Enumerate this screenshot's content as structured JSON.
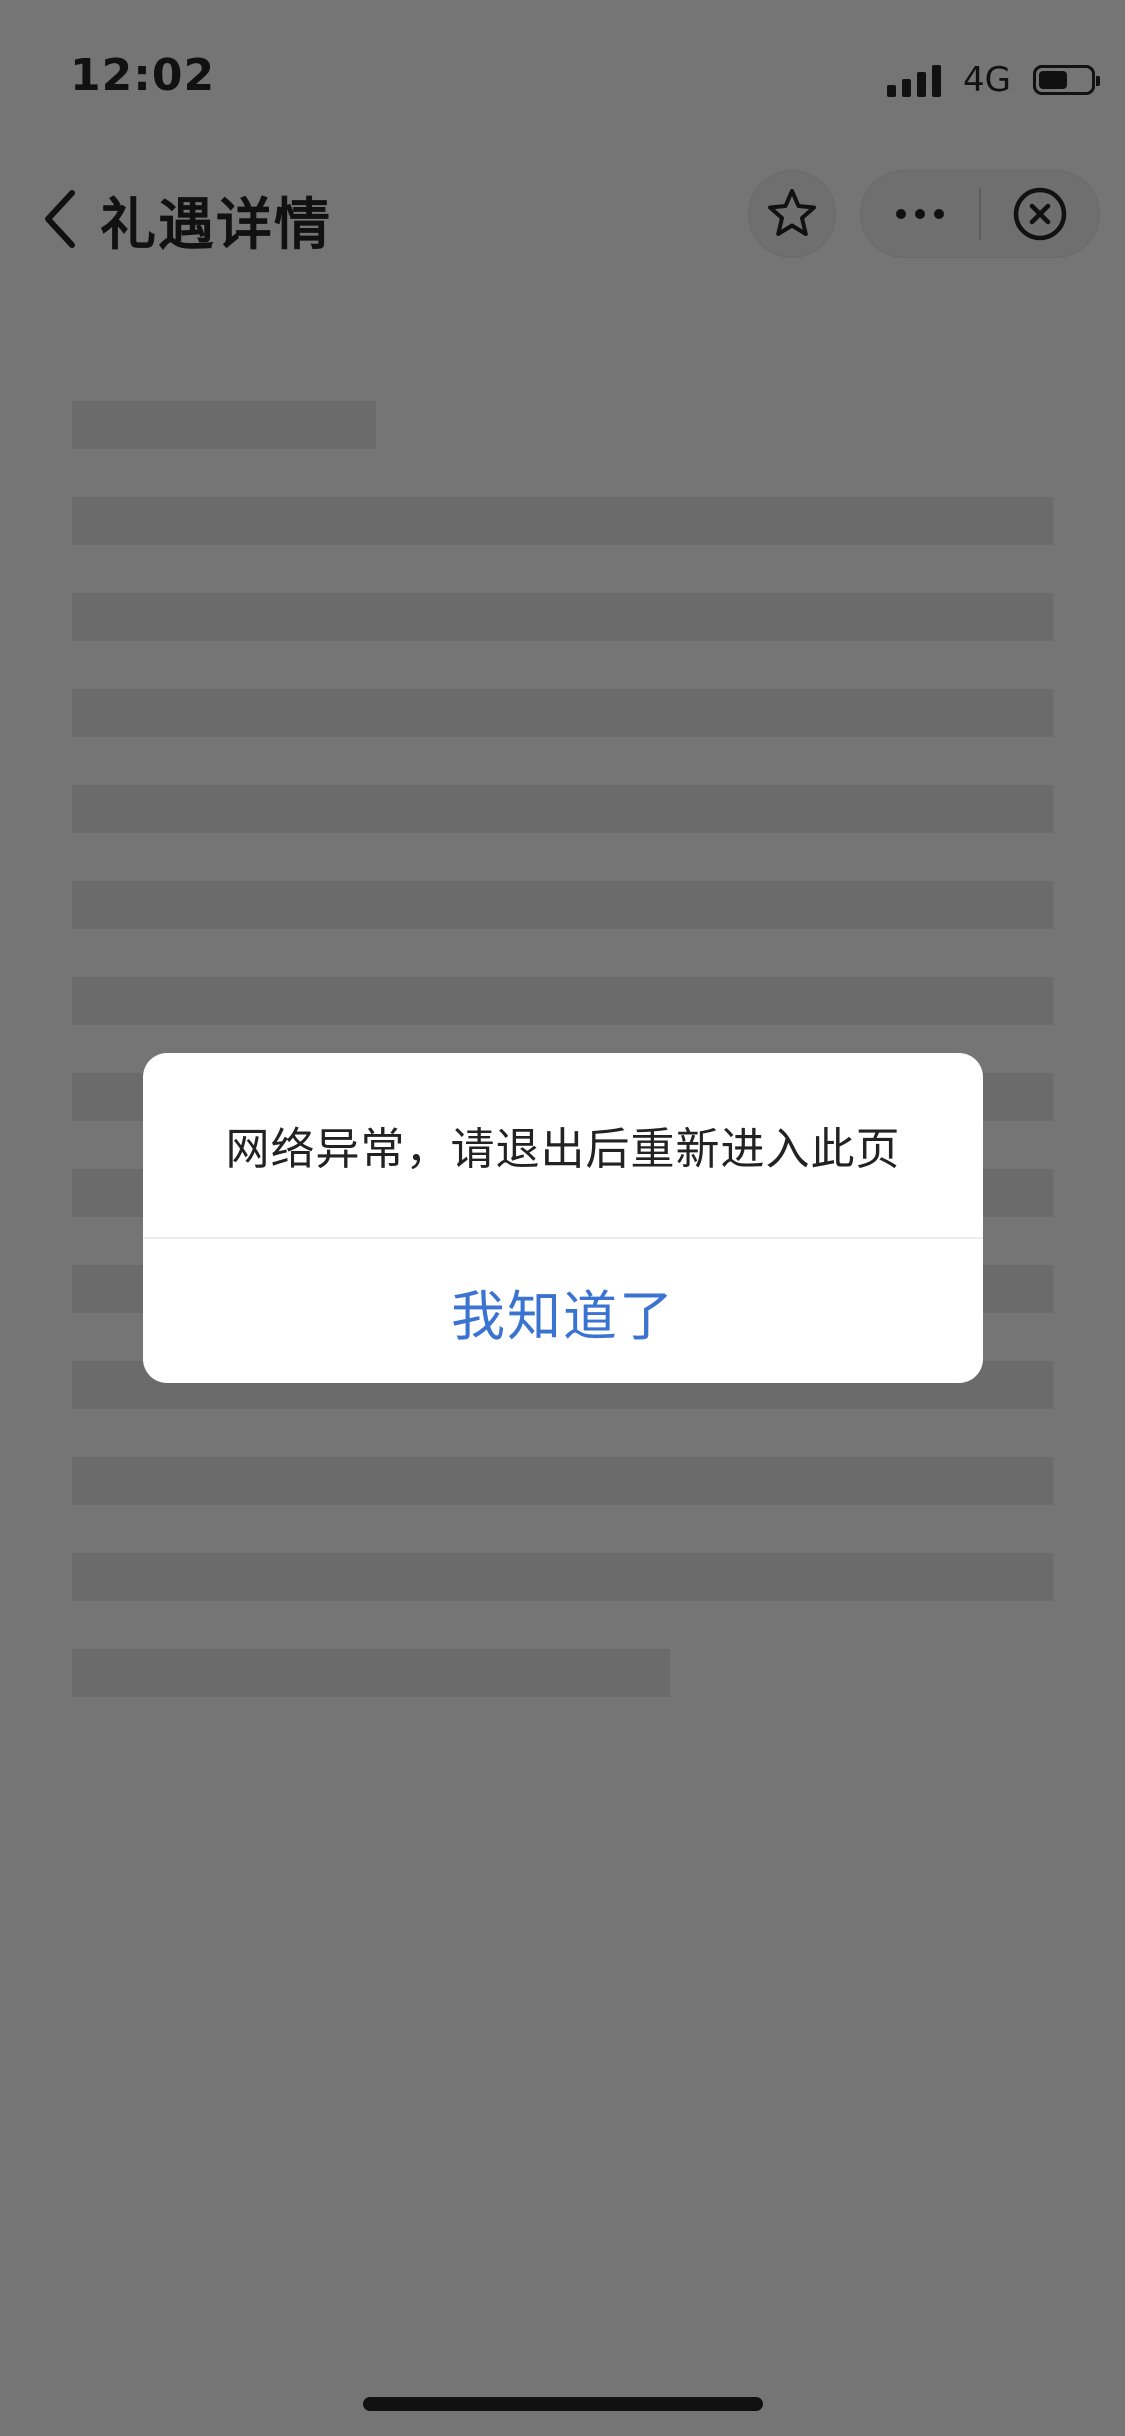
{
  "status_bar": {
    "time": "12:02",
    "network": "4G",
    "battery_level": 0.55
  },
  "nav": {
    "title": "礼遇详情",
    "icons": [
      "chevron-left-icon",
      "star-icon",
      "more-icon",
      "close-circle-icon"
    ]
  },
  "dialog": {
    "message": "网络异常，请退出后重新进入此页",
    "confirm_label": "我知道了",
    "confirm_color": "#3b73d0"
  },
  "colors": {
    "overlay_background": "#757575",
    "skeleton": "#6b6b6b",
    "dialog_background": "#ffffff"
  }
}
